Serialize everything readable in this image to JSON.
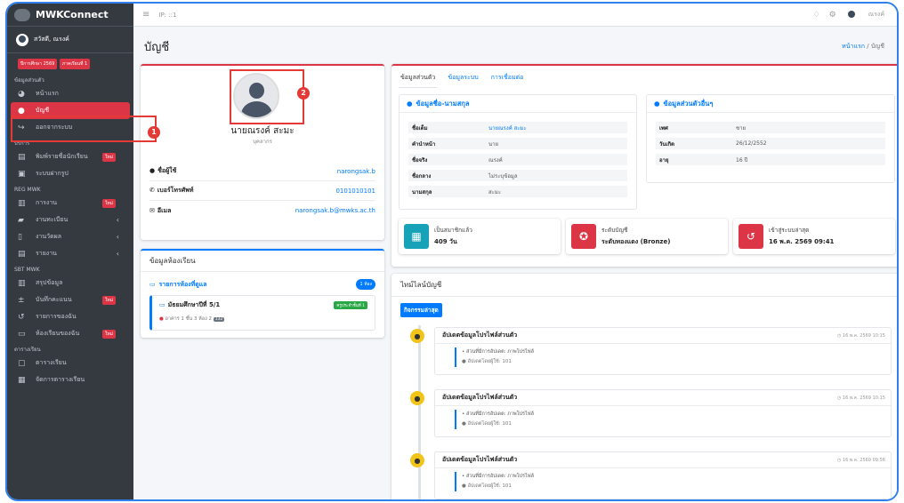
{
  "app": {
    "brand": "MWKConnect"
  },
  "sidebar": {
    "user_name": "สวัสดี, ณรงค์",
    "badges": [
      "ปีการศึกษา 2569",
      "ภาคเรียนที่ 1"
    ],
    "sections": [
      {
        "title": "ข้อมูลส่วนตัว",
        "items": [
          {
            "label": "หน้าแรก",
            "icon": "gauge-icon"
          },
          {
            "label": "บัญชี",
            "icon": "user-icon",
            "active": true
          },
          {
            "label": "ออกจากระบบ",
            "icon": "logout-icon"
          }
        ]
      },
      {
        "title": "บริการ",
        "items": [
          {
            "label": "พิมพ์รายชื่อนักเรียน",
            "icon": "print-icon",
            "badge": "ใหม่"
          },
          {
            "label": "ระบบฝากรูป",
            "icon": "image-icon"
          }
        ]
      },
      {
        "title": "REG MWK",
        "items": [
          {
            "label": "การงาน",
            "icon": "chart-icon",
            "badge": "ใหม่"
          },
          {
            "label": "งานทะเบียน",
            "icon": "folder-icon",
            "chevron": true
          },
          {
            "label": "งานวัดผล",
            "icon": "clipboard-icon",
            "chevron": true
          },
          {
            "label": "รายงาน",
            "icon": "print-icon",
            "chevron": true
          }
        ]
      },
      {
        "title": "SBT MWK",
        "items": [
          {
            "label": "สรุปข้อมูล",
            "icon": "chart-icon"
          },
          {
            "label": "บันทึกคะแนน",
            "icon": "plus-minus-icon",
            "badge": "ใหม่"
          },
          {
            "label": "รายการของฉัน",
            "icon": "history-icon"
          },
          {
            "label": "ห้องเรียนของฉัน",
            "icon": "chalkboard-icon",
            "badge": "ใหม่"
          }
        ]
      },
      {
        "title": "ตารางเรียน",
        "items": [
          {
            "label": "ตารางเรียน",
            "icon": "calendar-icon"
          },
          {
            "label": "จัดการตารางเรียน",
            "icon": "calendar-edit-icon"
          }
        ]
      }
    ]
  },
  "topbar": {
    "ip": "IP: ::1",
    "user": "ณรงค์"
  },
  "page": {
    "title": "บัญชี",
    "breadcrumb_home": "หน้าแรก",
    "breadcrumb_sep": "/",
    "breadcrumb_current": "บัญชี"
  },
  "profile": {
    "name": "นายณรงค์ สะมะ",
    "role": "บุคลากร",
    "rows": [
      {
        "label": "ชื่อผู้ใช้",
        "value": "narongsak.b",
        "icon": "user-icon"
      },
      {
        "label": "เบอร์โทรศัพท์",
        "value": "0101010101",
        "icon": "phone-icon"
      },
      {
        "label": "อีเมล",
        "value": "narongsak.b@mwks.ac.th",
        "icon": "envelope-icon"
      }
    ]
  },
  "classroom": {
    "header": "ข้อมูลห้องเรียน",
    "list_title": "รายการห้องที่ดูแล",
    "count": "1 ห้อง",
    "item_name": "มัธยมศึกษาปีที่ 5/1",
    "item_tag": "ครูประจำชั้นที่ 1",
    "item_location": "อาคาร 1 ชั้น 3 ห้อง 2",
    "item_room_code": "132"
  },
  "tabs": [
    "ข้อมูลส่วนตัว",
    "ข้อมูลระบบ",
    "การเชื่อมต่อ"
  ],
  "personal": {
    "title": "ข้อมูลชื่อ-นามสกุล",
    "rows": [
      {
        "k": "ชื่อเต็ม",
        "v": "นายณรงค์ สะมะ",
        "link": true
      },
      {
        "k": "คำนำหน้า",
        "v": "นาย"
      },
      {
        "k": "ชื่อจริง",
        "v": "ณรงค์"
      },
      {
        "k": "ชื่อกลาง",
        "v": "ไม่ระบุข้อมูล"
      },
      {
        "k": "นามสกุล",
        "v": "สะมะ"
      }
    ]
  },
  "other": {
    "title": "ข้อมูลส่วนตัวอื่นๆ",
    "rows": [
      {
        "k": "เพศ",
        "v": "ชาย"
      },
      {
        "k": "วันเกิด",
        "v": "26/12/2552"
      },
      {
        "k": "อายุ",
        "v": "16 ปี"
      }
    ]
  },
  "stats": [
    {
      "label": "เป็นสมาชิกแล้ว",
      "value": "409 วัน",
      "color": "#17a2b8",
      "icon": "calendar-icon"
    },
    {
      "label": "ระดับบัญชี",
      "value": "ระดับทองแดง (Bronze)",
      "color": "#dc3545",
      "icon": "medal-icon"
    },
    {
      "label": "เข้าสู่ระบบล่าสุด",
      "value": "16 พ.ค. 2569 09:41",
      "color": "#dc3545",
      "icon": "history-icon"
    }
  ],
  "timeline": {
    "header": "ไทม์ไลน์บัญชี",
    "badge": "กิจกรรมล่าสุด",
    "items": [
      {
        "title": "อัปเดตข้อมูลโปรไฟล์ส่วนตัว",
        "time": "16 พ.ค. 2569 10:15",
        "change": "ส่วนที่มีการอัปเดต: ภาพโปรไฟล์",
        "by": "อัปเดตโดยผู้ใช้: 101"
      },
      {
        "title": "อัปเดตข้อมูลโปรไฟล์ส่วนตัว",
        "time": "16 พ.ค. 2569 10:15",
        "change": "ส่วนที่มีการอัปเดต: ภาพโปรไฟล์",
        "by": "อัปเดตโดยผู้ใช้: 101"
      },
      {
        "title": "อัปเดตข้อมูลโปรไฟล์ส่วนตัว",
        "time": "16 พ.ค. 2569 09:56",
        "change": "ส่วนที่มีการอัปเดต: ภาพโปรไฟล์",
        "by": "อัปเดตโดยผู้ใช้: 101"
      }
    ]
  },
  "annotations": [
    "1",
    "2"
  ]
}
